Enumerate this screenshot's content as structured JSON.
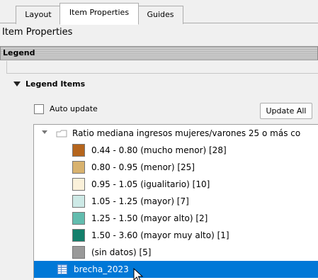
{
  "tabs": [
    {
      "label": "Layout"
    },
    {
      "label": "Item Properties"
    },
    {
      "label": "Guides"
    }
  ],
  "panel_title": "Item Properties",
  "legend_header": "Legend",
  "legend_items_header": "Legend Items",
  "auto_update_label": "Auto update",
  "update_all_label": "Update All",
  "tree": {
    "layer_name": "Ratio mediana ingresos mujeres/varones 25 o más co",
    "classes": [
      {
        "label": "0.44 - 0.80 (mucho menor) [28]",
        "color": "#b5651d"
      },
      {
        "label": "0.80 - 0.95 (menor) [25]",
        "color": "#d8b26e"
      },
      {
        "label": "0.95 - 1.05 (igualitario) [10]",
        "color": "#fbf1da"
      },
      {
        "label": "1.05 - 1.25 (mayor) [7]",
        "color": "#cde9e6"
      },
      {
        "label": "1.25 - 1.50 (mayor alto) [2]",
        "color": "#62bcae"
      },
      {
        "label": "1.50 - 3.60 (mayor muy alto) [1]",
        "color": "#137f6b"
      },
      {
        "label": "(sin datos) [5]",
        "color": "#999999"
      }
    ],
    "selected_table": "brecha_2023"
  },
  "colors": {
    "selection": "#0078d7",
    "header_gray": "#bcbcbc"
  }
}
